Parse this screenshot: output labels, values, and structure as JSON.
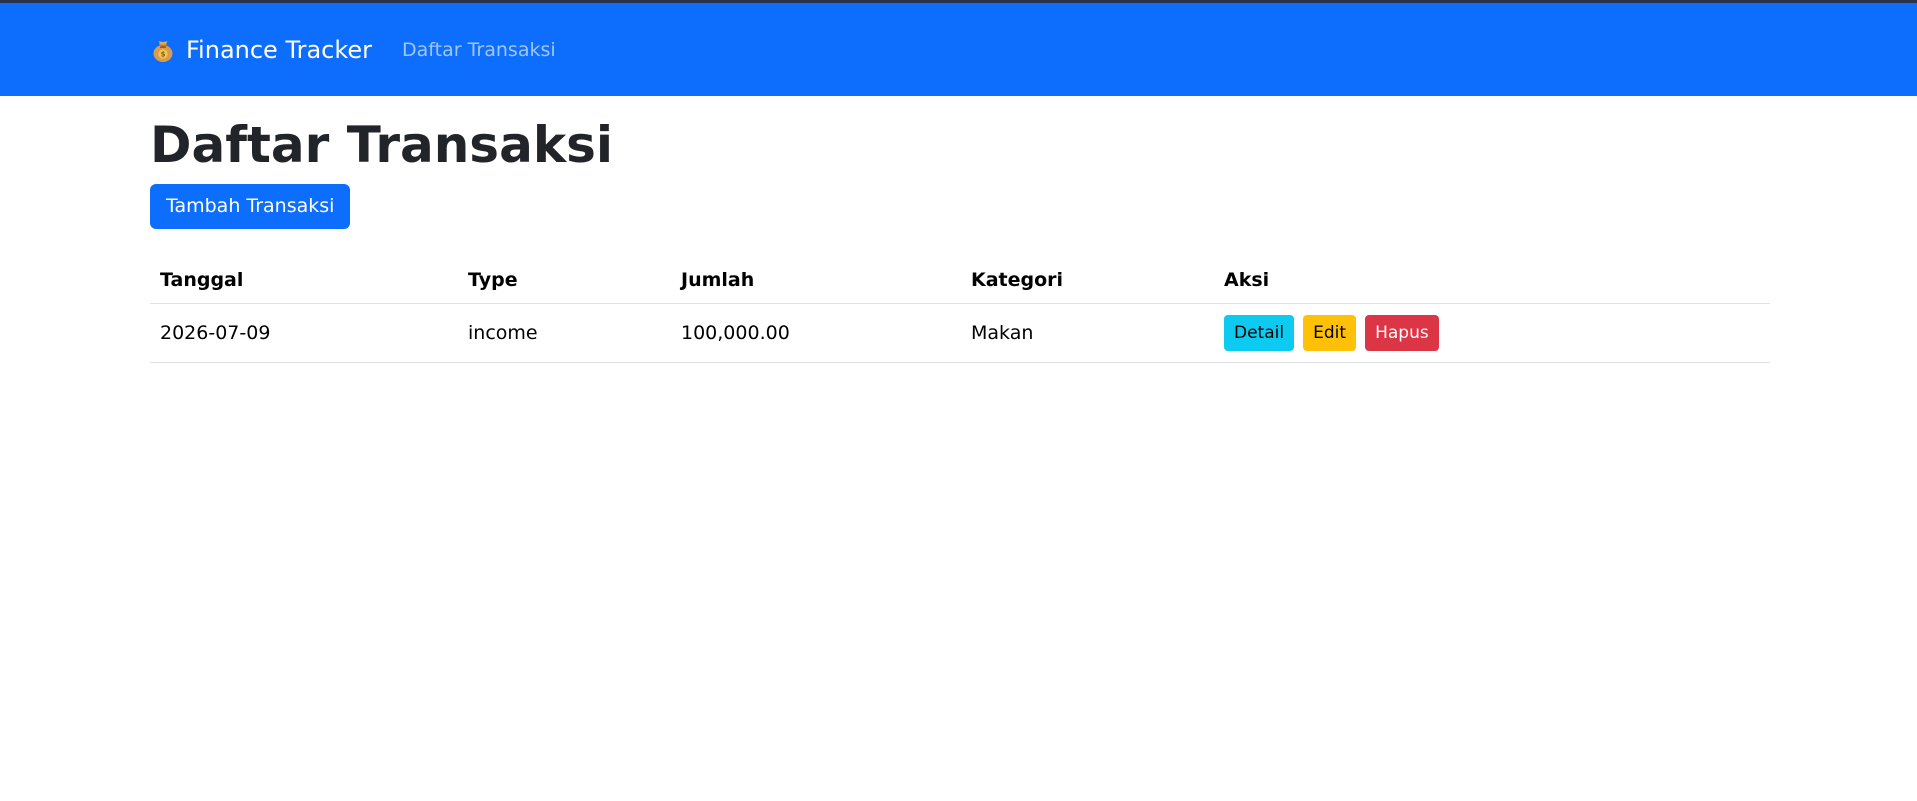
{
  "navbar": {
    "brand_label": "Finance Tracker",
    "brand_icon": "money-bag-icon",
    "links": [
      {
        "label": "Daftar Transaksi"
      }
    ],
    "bg_color": "#0d6efd"
  },
  "page": {
    "title": "Daftar Transaksi",
    "add_button_label": "Tambah Transaksi"
  },
  "table": {
    "headers": [
      "Tanggal",
      "Type",
      "Jumlah",
      "Kategori",
      "Aksi"
    ],
    "rows": [
      {
        "tanggal": "2026-07-09",
        "type": "income",
        "jumlah": "100,000.00",
        "kategori": "Makan",
        "actions": {
          "detail_label": "Detail",
          "edit_label": "Edit",
          "delete_label": "Hapus"
        }
      }
    ]
  },
  "colors": {
    "primary": "#0d6efd",
    "info": "#0dcaf0",
    "warning": "#ffc107",
    "danger": "#dc3545"
  }
}
